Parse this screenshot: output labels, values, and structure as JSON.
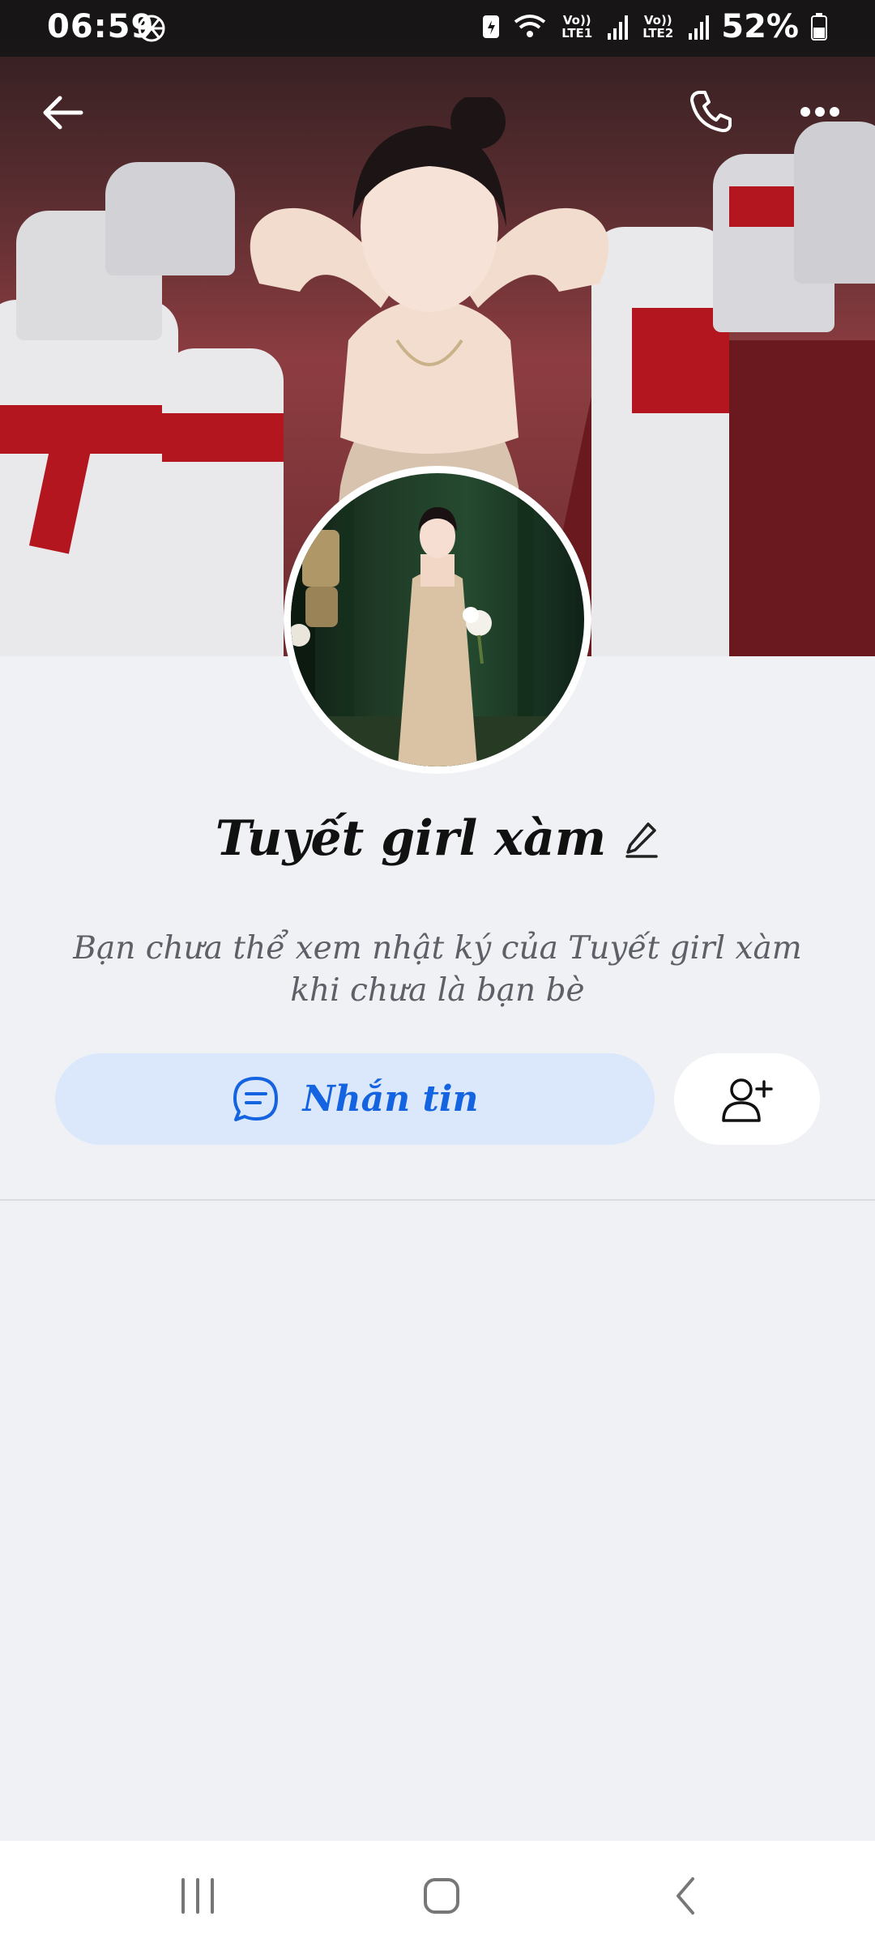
{
  "status_bar": {
    "time": "06:59",
    "network_1": "Vo)) LTE1",
    "network_2": "Vo)) LTE2",
    "battery": "52%"
  },
  "header": {
    "back_icon": "arrow-left-icon",
    "call_icon": "phone-icon",
    "more_icon": "more-horizontal-icon"
  },
  "profile": {
    "name": "Tuyết girl xàm",
    "edit_icon": "pencil-icon",
    "notice": "Bạn chưa thể xem nhật ký của Tuyết girl xàm khi chưa là bạn bè"
  },
  "actions": {
    "message_label": "Nhắn tin",
    "message_icon": "chat-bubble-icon",
    "add_friend_icon": "add-friend-icon"
  },
  "nav": {
    "recents_icon": "recents-icon",
    "home_icon": "home-icon",
    "back_icon": "back-icon"
  },
  "colors": {
    "accent": "#1463e0",
    "button_bg": "#dbe8fc",
    "page_bg": "#f0f1f5"
  }
}
